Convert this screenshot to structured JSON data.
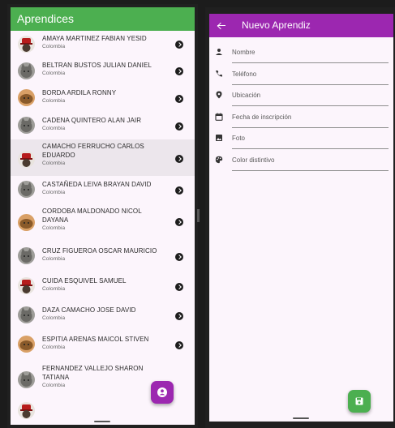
{
  "list_screen": {
    "title": "Aprendices",
    "items": [
      {
        "name": "AMAYA MARTINEZ FABIAN YESID",
        "sub": "Colombia",
        "avatar": "red-hat"
      },
      {
        "name": "BELTRAN BUSTOS JULIAN DANIEL",
        "sub": "Colombia",
        "avatar": "gray-cat"
      },
      {
        "name": "BORDA ARDILA RONNY",
        "sub": "Colombia",
        "avatar": "orange-cat"
      },
      {
        "name": "CADENA QUINTERO ALAN JAIR",
        "sub": "Colombia",
        "avatar": "gray-cat"
      },
      {
        "name": "CAMACHO FERRUCHO CARLOS EDUARDO",
        "sub": "Colombia",
        "avatar": "red-hat"
      },
      {
        "name": "CASTAÑEDA LEIVA BRAYAN DAVID",
        "sub": "Colombia",
        "avatar": "gray-cat"
      },
      {
        "name": "CORDOBA MALDONADO NICOL DAYANA",
        "sub": "Colombia",
        "avatar": "orange-cat"
      },
      {
        "name": "CRUZ FIGUEROA OSCAR MAURICIO",
        "sub": "Colombia",
        "avatar": "gray-cat"
      },
      {
        "name": "CUIDA ESQUIVEL SAMUEL",
        "sub": "Colombia",
        "avatar": "red-hat"
      },
      {
        "name": "DAZA CAMACHO JOSE DAVID",
        "sub": "Colombia",
        "avatar": "gray-cat"
      },
      {
        "name": "ESPITIA ARENAS MAICOL STIVEN",
        "sub": "Colombia",
        "avatar": "orange-cat"
      },
      {
        "name": "FERNANDEZ VALLEJO SHARON TATIANA",
        "sub": "Colombia",
        "avatar": "gray-cat"
      }
    ]
  },
  "form_screen": {
    "title": "Nuevo Aprendiz",
    "fields": [
      {
        "label": "Nombre",
        "icon": "person-icon"
      },
      {
        "label": "Teléfono",
        "icon": "phone-icon"
      },
      {
        "label": "Ubicación",
        "icon": "location-icon"
      },
      {
        "label": "Fecha de inscripción",
        "icon": "calendar-icon"
      },
      {
        "label": "Foto",
        "icon": "image-icon"
      },
      {
        "label": "Color distintivo",
        "icon": "palette-icon"
      }
    ]
  },
  "colors": {
    "list_appbar": "#4caf50",
    "form_appbar": "#9c27b0",
    "add_fab": "#9c27b0",
    "save_fab": "#4caf50",
    "background": "#fcf5fc"
  }
}
